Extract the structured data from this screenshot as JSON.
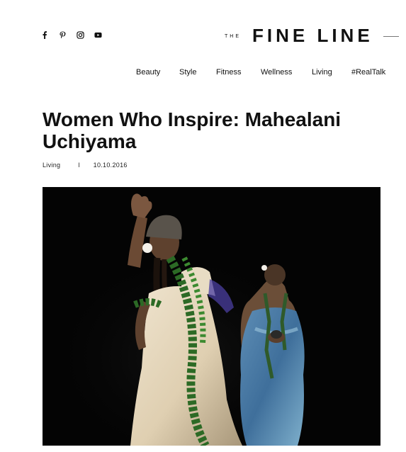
{
  "header": {
    "social": [
      {
        "icon": "facebook-icon"
      },
      {
        "icon": "pinterest-icon"
      },
      {
        "icon": "instagram-icon"
      },
      {
        "icon": "youtube-icon"
      }
    ],
    "brand_prefix": "THE",
    "brand_name": "FINE LINE"
  },
  "nav": {
    "items": [
      "Beauty",
      "Style",
      "Fitness",
      "Wellness",
      "Living",
      "#RealTalk"
    ]
  },
  "article": {
    "title": "Women Who Inspire: Mahealani Uchiyama",
    "category": "Living",
    "separator": "l",
    "date": "10.10.2016"
  },
  "colors": {
    "text": "#111111",
    "photo_background": "#040404"
  }
}
